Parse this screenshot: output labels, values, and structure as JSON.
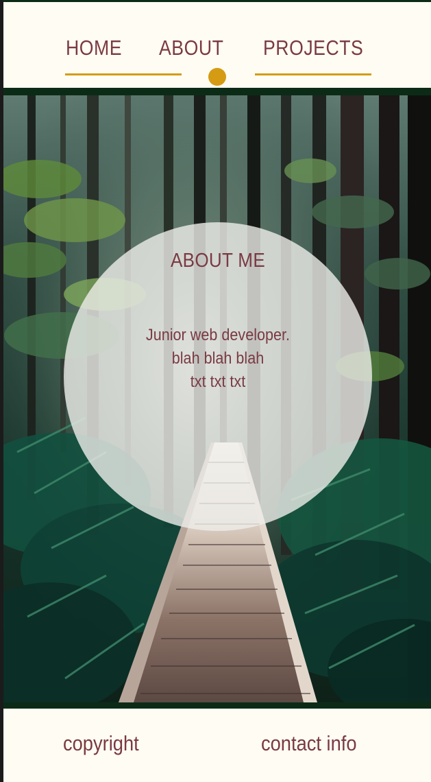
{
  "nav": {
    "items": [
      {
        "label": "HOME"
      },
      {
        "label": "ABOUT"
      },
      {
        "label": "PROJECTS"
      }
    ],
    "active_item": "ABOUT"
  },
  "about": {
    "title": "ABOUT ME",
    "lines": [
      "Junior web developer.",
      "blah blah blah",
      "txt txt txt"
    ]
  },
  "footer": {
    "left_label": "copyright",
    "right_label": "contact info"
  },
  "colors": {
    "accent_gold": "#d59b13",
    "text_maroon": "#7a3a42",
    "dark_green": "#0c2b17",
    "background": "#fffcf3"
  }
}
